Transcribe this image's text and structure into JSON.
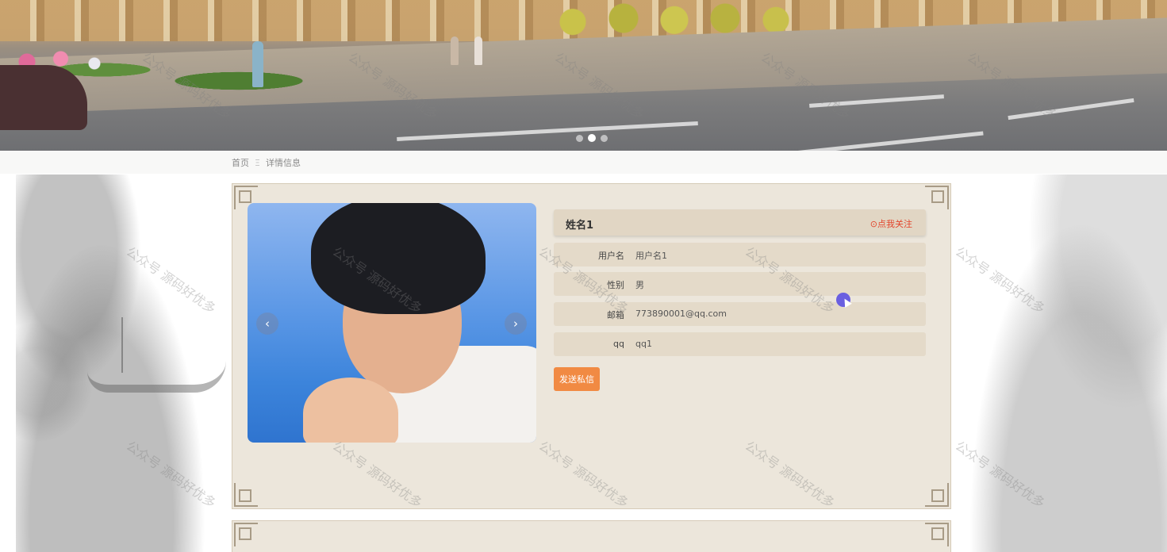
{
  "banner": {
    "slides": [
      "slide-1",
      "slide-2",
      "slide-3"
    ],
    "active_slide": 2
  },
  "breadcrumb": {
    "home": "首页",
    "separator": "Ξ",
    "current": "详情信息"
  },
  "profile": {
    "name": "姓名1",
    "follow_label": "⊙点我关注",
    "fields": [
      {
        "label": "用户名",
        "value": "用户名1"
      },
      {
        "label": "性别",
        "value": "男"
      },
      {
        "label": "邮箱",
        "value": "773890001@qq.com"
      },
      {
        "label": "qq",
        "value": "qq1"
      }
    ],
    "send_message_label": "发送私信"
  },
  "carousel": {
    "prev_label": "‹",
    "next_label": "›"
  },
  "watermark": "公众号 源码好优多",
  "colors": {
    "panel_bg": "#ece6db",
    "row_bg": "#e4dac9",
    "header_bg": "#e1d6c4",
    "follow_red": "#e2442b",
    "button_orange": "#f18a43"
  }
}
